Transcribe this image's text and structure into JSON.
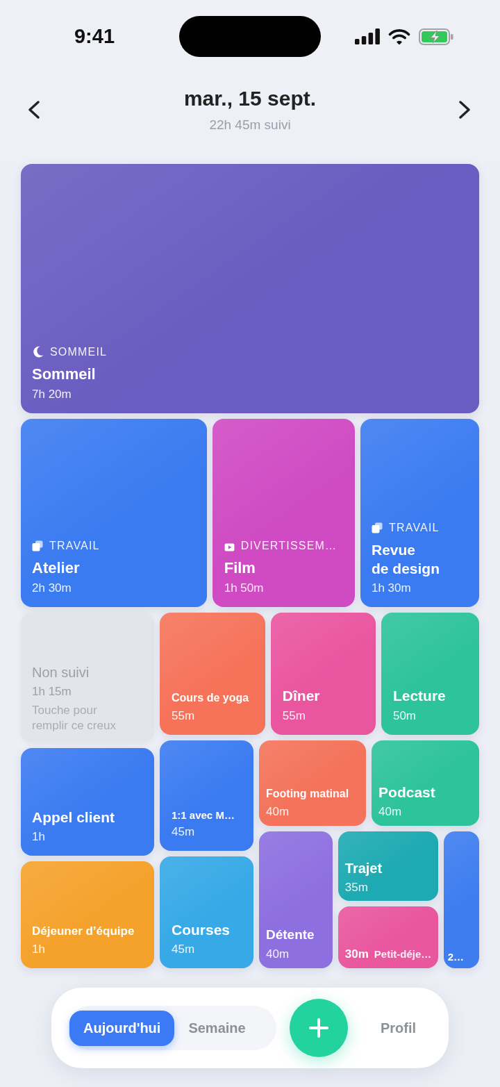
{
  "status_bar": {
    "time": "9:41"
  },
  "header": {
    "date": "mar., 15 sept.",
    "subtitle": "22h 45m suivi"
  },
  "tiles": [
    {
      "kind": "activity",
      "category": {
        "label": "SOMMEIL",
        "kind": "sleep"
      },
      "title": "Sommeil",
      "duration": "7h 20m",
      "color": "#6a5cc0"
    },
    {
      "kind": "activity",
      "category": {
        "label": "TRAVAIL",
        "kind": "work"
      },
      "title": "Atelier",
      "duration": "2h 30m",
      "color": "#3b7bf1"
    },
    {
      "kind": "activity",
      "category": {
        "label": "DIVERTISSEM…",
        "kind": "entertainment"
      },
      "title": "Film",
      "duration": "1h 50m",
      "color": "#cf4ac3"
    },
    {
      "kind": "activity",
      "category": {
        "label": "TRAVAIL",
        "kind": "work"
      },
      "title": "Revue\nde design",
      "duration": "1h 30m",
      "color": "#3b7bf1"
    },
    {
      "kind": "untracked",
      "title": "Non suivi",
      "duration": "1h 15m",
      "hint": "Touche pour\nremplir ce creux",
      "color": "#e3e5ea"
    },
    {
      "kind": "activity",
      "title": "Appel client",
      "duration": "1h",
      "color": "#3b7bf1"
    },
    {
      "kind": "activity",
      "title": "Déjeuner d’équipe",
      "duration": "1h",
      "color": "#f5a22c"
    },
    {
      "kind": "activity",
      "title": "Cours de yoga",
      "duration": "55m",
      "color": "#f6735a"
    },
    {
      "kind": "activity",
      "title": "Dîner",
      "duration": "55m",
      "color": "#ea55a0"
    },
    {
      "kind": "activity",
      "title": "Lecture",
      "duration": "50m",
      "color": "#2dc39b"
    },
    {
      "kind": "activity",
      "title": "1:1 avec M…",
      "duration": "45m",
      "color": "#3b7bf1"
    },
    {
      "kind": "activity",
      "title": "Courses",
      "duration": "45m",
      "color": "#36a9e6"
    },
    {
      "kind": "activity",
      "title": "Footing matinal",
      "duration": "40m",
      "color": "#f4735a"
    },
    {
      "kind": "activity",
      "title": "Podcast",
      "duration": "40m",
      "color": "#2dc39b"
    },
    {
      "kind": "activity",
      "title": "Détente",
      "duration": "40m",
      "color": "#8d6fe0"
    },
    {
      "kind": "activity",
      "title": "Trajet",
      "duration": "35m",
      "color": "#1eaab2"
    },
    {
      "kind": "inline",
      "duration": "30m",
      "title": "Petit-déje…",
      "color": "#e9579f"
    },
    {
      "kind": "overflow",
      "text": "2…",
      "color": "#3d7df0"
    }
  ],
  "tab_bar": {
    "segments": [
      {
        "label": "Aujourd'hui",
        "selected": true
      },
      {
        "label": "Semaine",
        "selected": false
      }
    ],
    "profile": {
      "label": "Profil",
      "selected": false
    }
  }
}
